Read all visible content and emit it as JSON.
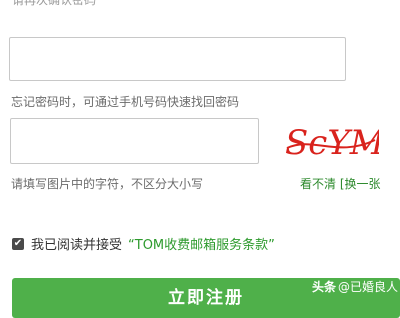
{
  "form": {
    "confirm_password_placeholder": "请再次确认密码",
    "forgot_hint": "忘记密码时，可通过手机号码快速找回密码",
    "captcha_hint": "请填写图片中的字符，不区分大小写",
    "captcha_text": "ScYM",
    "cant_see": "看不清",
    "refresh": "[换一张",
    "agree_text": "我已阅读并接受",
    "terms_link": "“TOM收费邮箱服务条款”",
    "submit_label": "立即注册"
  },
  "watermark": {
    "logo": "头条",
    "author": "@已婚良人"
  },
  "colors": {
    "accent_green": "#4fb04a",
    "link_green": "#2d9a2d",
    "captcha_red": "#d9231d"
  }
}
